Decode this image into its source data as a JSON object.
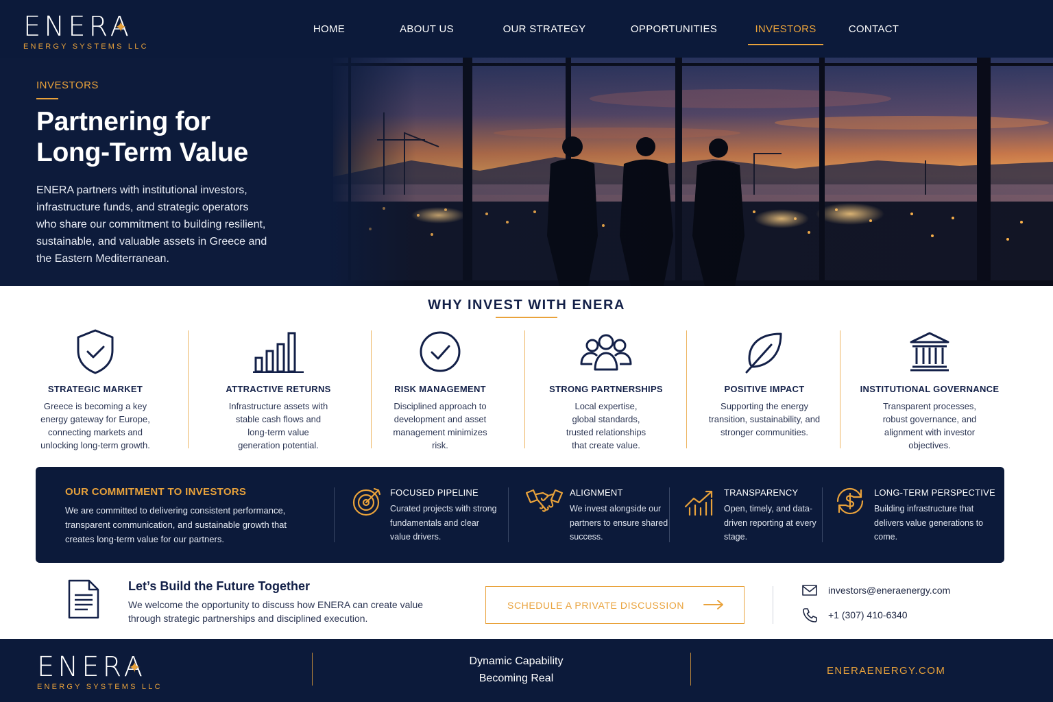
{
  "brand": {
    "name": "ENERA",
    "subtitle": "ENERGY SYSTEMS LLC",
    "accent_color": "#e9a23b",
    "navy_color": "#0c1a3a"
  },
  "nav": {
    "items": [
      {
        "label": "HOME",
        "active": false
      },
      {
        "label": "ABOUT US",
        "active": false
      },
      {
        "label": "OUR STRATEGY",
        "active": false
      },
      {
        "label": "OPPORTUNITIES",
        "active": false
      },
      {
        "label": "INVESTORS",
        "active": true
      },
      {
        "label": "CONTACT",
        "active": false
      }
    ]
  },
  "hero": {
    "eyebrow": "INVESTORS",
    "title_line1": "Partnering for",
    "title_line2": "Long-Term Value",
    "body": "ENERA partners with institutional investors, infrastructure funds, and strategic operators who share our commitment to building resilient, sustainable, and valuable assets in Greece and the Eastern Mediterranean.",
    "image": "silhouettes-of-three-people-at-window-overlooking-industrial-port-at-sunset"
  },
  "why": {
    "title": "WHY INVEST WITH ENERA",
    "features": [
      {
        "icon": "shield-check-icon",
        "title": "STRATEGIC MARKET",
        "body": "Greece is becoming a key energy gateway for Europe, connecting markets and unlocking long-term growth."
      },
      {
        "icon": "bar-chart-icon",
        "title": "ATTRACTIVE RETURNS",
        "body": "Infrastructure assets with stable cash flows and long-term value generation potential."
      },
      {
        "icon": "check-circle-icon",
        "title": "RISK MANAGEMENT",
        "body": "Disciplined approach to development and asset management minimizes risk."
      },
      {
        "icon": "people-group-icon",
        "title": "STRONG PARTNERSHIPS",
        "body": "Local expertise, global standards, trusted relationships that create value."
      },
      {
        "icon": "leaf-icon",
        "title": "POSITIVE IMPACT",
        "body": "Supporting the energy transition, sustainability, and stronger communities."
      },
      {
        "icon": "institution-icon",
        "title": "INSTITUTIONAL GOVERNANCE",
        "body": "Transparent processes, robust governance, and alignment with investor objectives."
      }
    ]
  },
  "commitment": {
    "title": "OUR COMMITMENT TO INVESTORS",
    "body": "We are committed to delivering consistent performance, transparent communication, and sustainable growth that creates long-term value for our partners.",
    "items": [
      {
        "icon": "target-icon",
        "title": "FOCUSED PIPELINE",
        "body": "Curated projects with strong fundamentals and clear value drivers."
      },
      {
        "icon": "handshake-icon",
        "title": "ALIGNMENT",
        "body": "We invest alongside our partners to ensure shared success."
      },
      {
        "icon": "trend-chart-icon",
        "title": "TRANSPARENCY",
        "body": "Open, timely, and data-driven reporting at every stage."
      },
      {
        "icon": "dollar-cycle-icon",
        "title": "LONG-TERM PERSPECTIVE",
        "body": "Building infrastructure that delivers value generations to come."
      }
    ]
  },
  "cta": {
    "title": "Let’s Build the Future Together",
    "body": "We welcome the opportunity to discuss how ENERA can create value through strategic partnerships and disciplined execution.",
    "button_label": "SCHEDULE A PRIVATE DISCUSSION",
    "email": "investors@eneraenergy.com",
    "phone": "+1 (307) 410-6340"
  },
  "footer": {
    "tagline_line1": "Dynamic Capability",
    "tagline_line2": "Becoming Real",
    "url": "ENERAENERGY.COM"
  }
}
